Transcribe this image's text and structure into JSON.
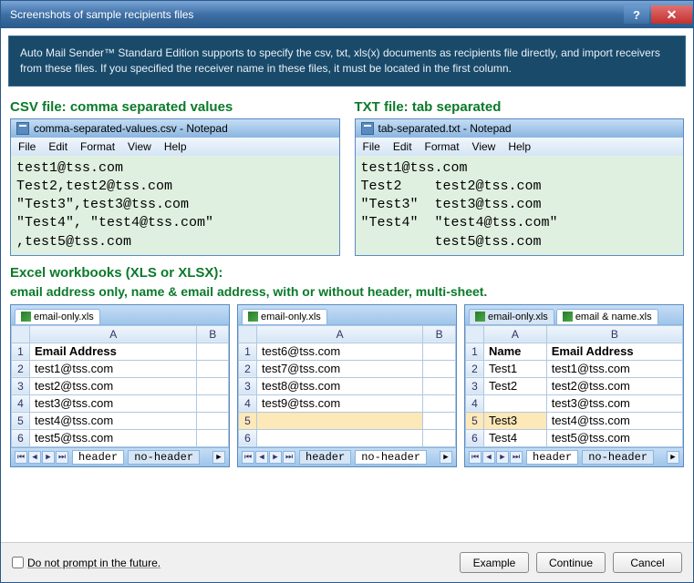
{
  "window": {
    "title": "Screenshots of sample recipients files"
  },
  "header": "Auto Mail Sender™ Standard Edition supports to specify the csv, txt, xls(x) documents as recipients file directly, and import receivers from these files. If you specified the receiver name in these files, it must be located in the first column.",
  "csv": {
    "title": "CSV file: comma separated values",
    "np_title": "comma-separated-values.csv - Notepad",
    "menu": [
      "File",
      "Edit",
      "Format",
      "View",
      "Help"
    ],
    "body": "test1@tss.com\nTest2,test2@tss.com\n\"Test3\",test3@tss.com\n\"Test4\", \"test4@tss.com\"\n,test5@tss.com"
  },
  "txt": {
    "title": "TXT file: tab separated",
    "np_title": "tab-separated.txt - Notepad",
    "menu": [
      "File",
      "Edit",
      "Format",
      "View",
      "Help"
    ],
    "body": "test1@tss.com\nTest2    test2@tss.com\n\"Test3\"  test3@tss.com\n\"Test4\"  \"test4@tss.com\"\n         test5@tss.com"
  },
  "excel_heading": "Excel workbooks (XLS or XLSX):",
  "excel_sub": "email address only, name & email address, with or without header, multi-sheet.",
  "excel1": {
    "tab": "email-only.xls",
    "cols": [
      "A",
      "B"
    ],
    "rows": [
      [
        "Email Address",
        ""
      ],
      [
        "test1@tss.com",
        ""
      ],
      [
        "test2@tss.com",
        ""
      ],
      [
        "test3@tss.com",
        ""
      ],
      [
        "test4@tss.com",
        ""
      ],
      [
        "test5@tss.com",
        ""
      ]
    ],
    "sheets": [
      "header",
      "no-header"
    ],
    "active_sheet": 0
  },
  "excel2": {
    "tab": "email-only.xls",
    "cols": [
      "A",
      "B"
    ],
    "rows": [
      [
        "test6@tss.com",
        ""
      ],
      [
        "test7@tss.com",
        ""
      ],
      [
        "test8@tss.com",
        ""
      ],
      [
        "test9@tss.com",
        ""
      ],
      [
        "",
        ""
      ],
      [
        "",
        ""
      ]
    ],
    "sheets": [
      "header",
      "no-header"
    ],
    "active_sheet": 1,
    "sel_row": 5
  },
  "excel3": {
    "tabs": [
      "email-only.xls",
      "email & name.xls"
    ],
    "cols": [
      "A",
      "B"
    ],
    "rows": [
      [
        "Name",
        "Email Address"
      ],
      [
        "Test1",
        "test1@tss.com"
      ],
      [
        "Test2",
        "test2@tss.com"
      ],
      [
        "",
        "test3@tss.com"
      ],
      [
        "Test3",
        "test4@tss.com"
      ],
      [
        "Test4",
        "test5@tss.com"
      ]
    ],
    "sheets": [
      "header",
      "no-header"
    ],
    "active_sheet": 0,
    "sel_row": 5
  },
  "footer": {
    "checkbox": "Do not prompt in the future.",
    "buttons": [
      "Example",
      "Continue",
      "Cancel"
    ]
  }
}
